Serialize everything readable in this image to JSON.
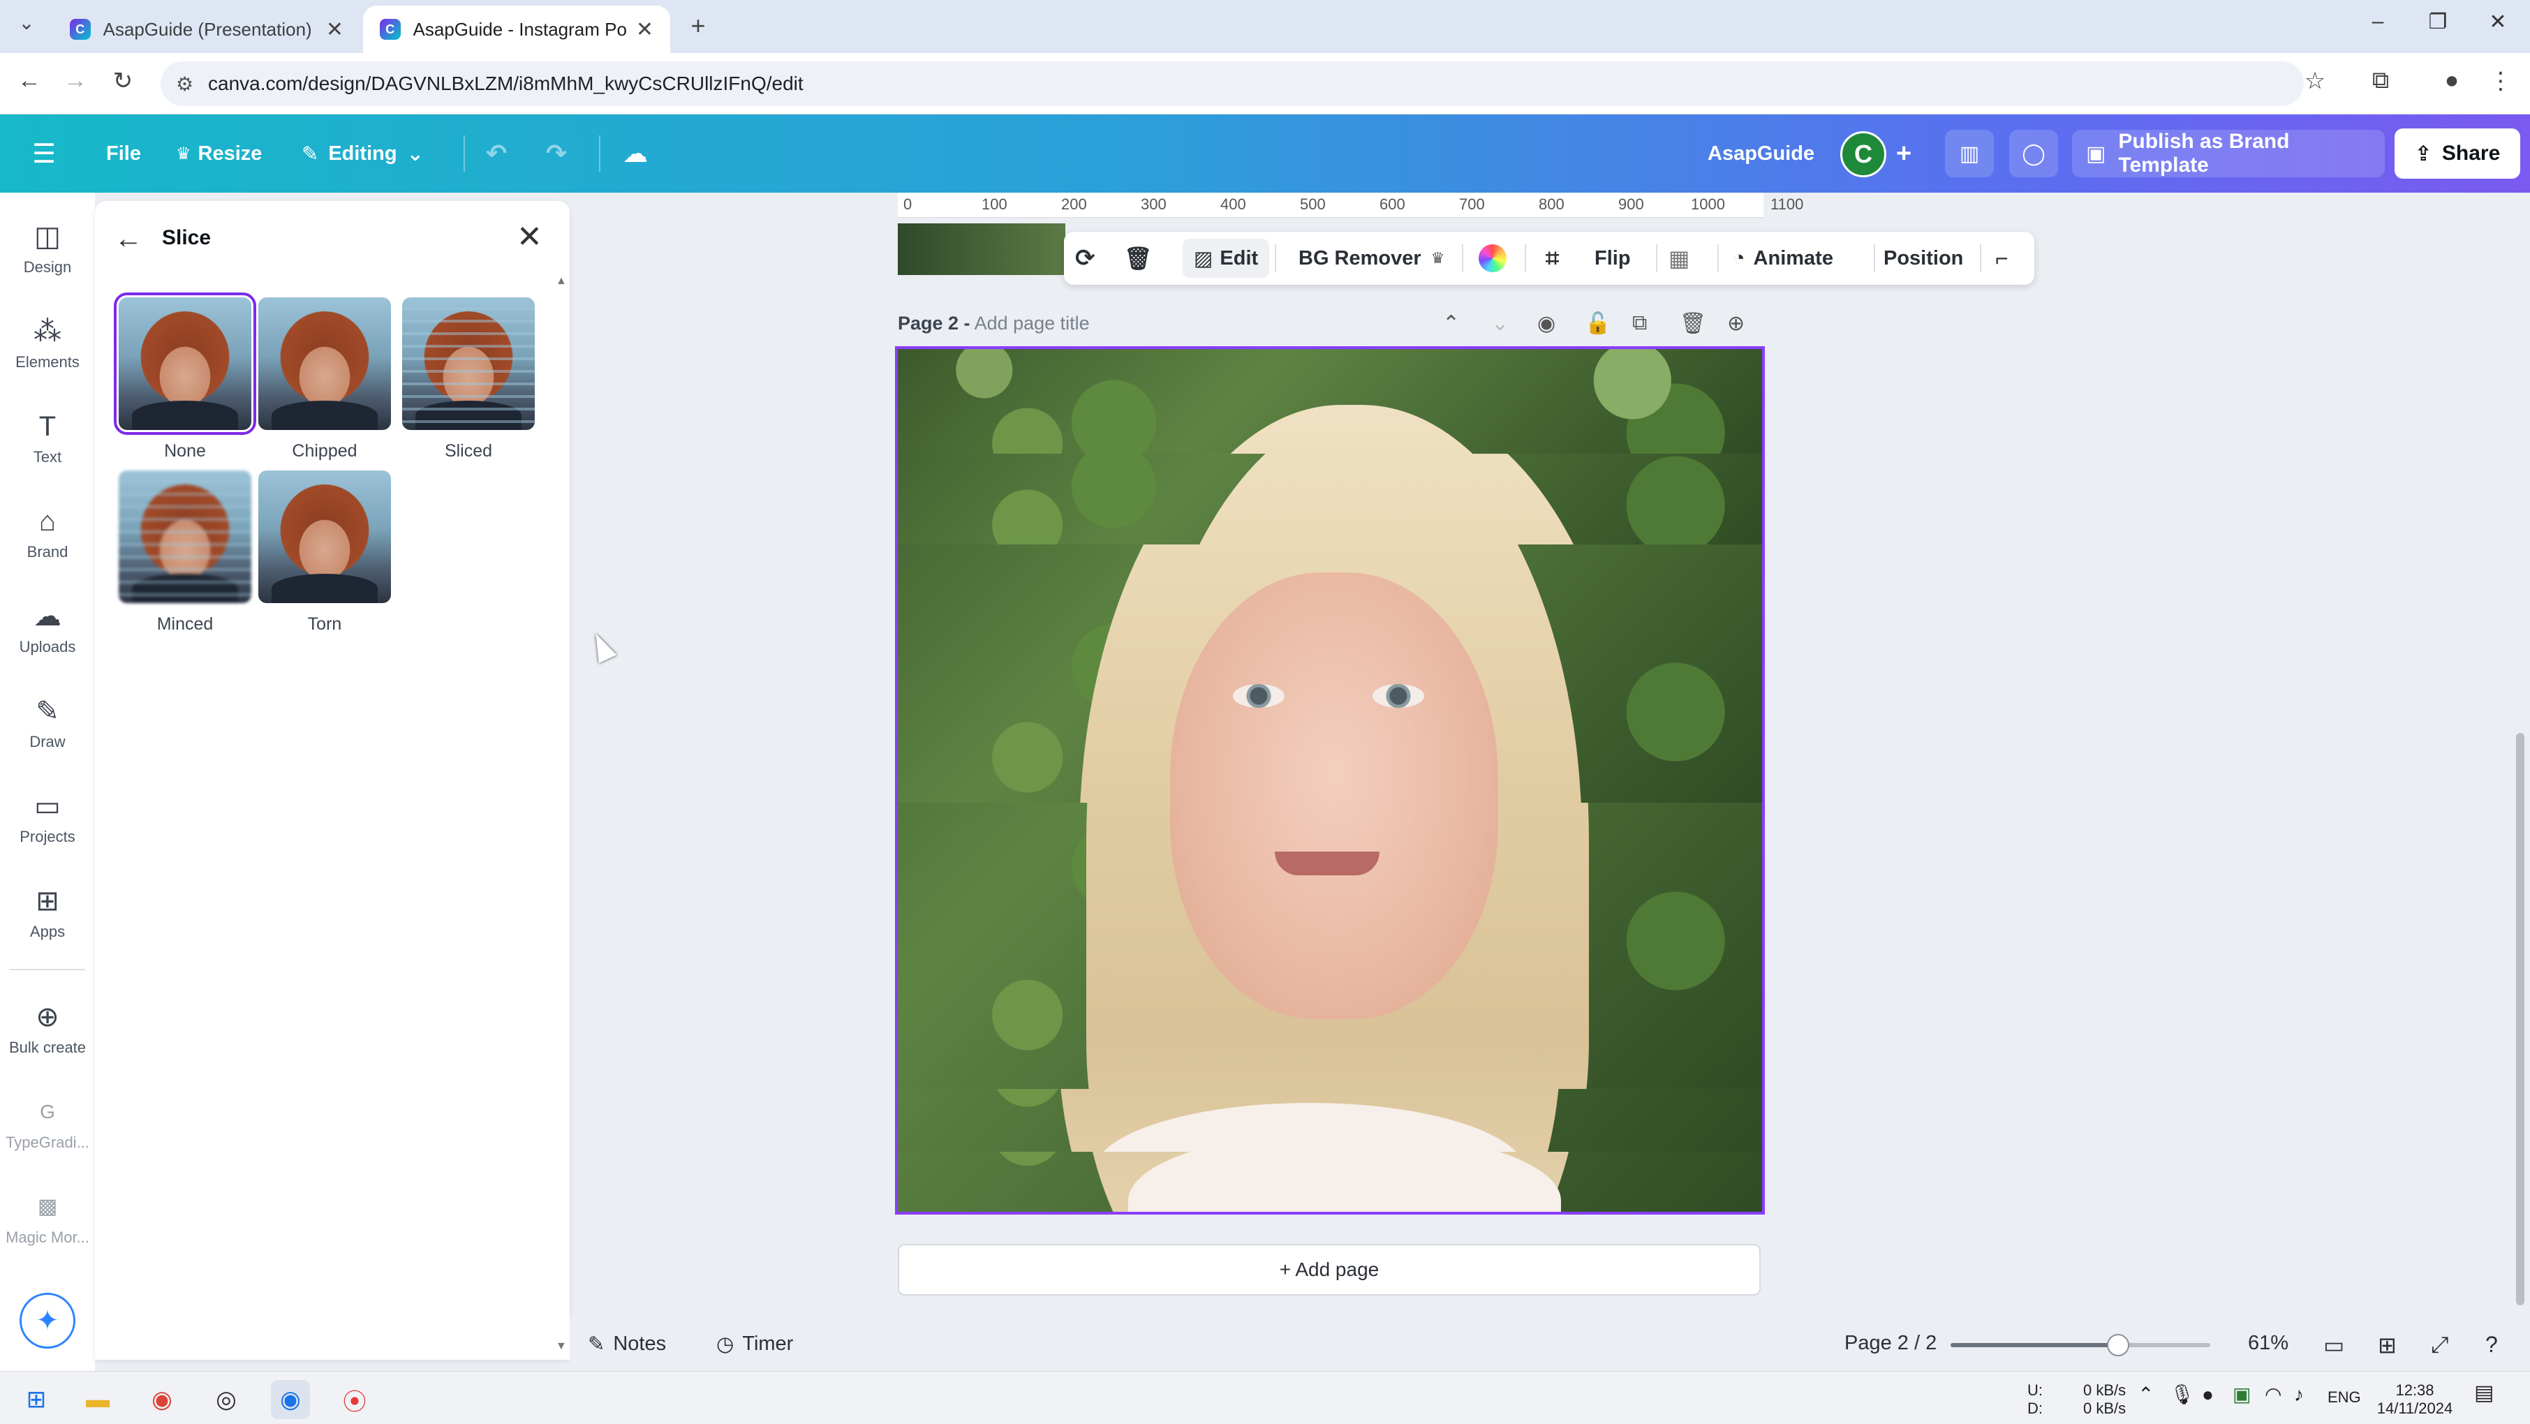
{
  "browser": {
    "tabs": [
      {
        "title": "AsapGuide (Presentation) - Pre",
        "active": false
      },
      {
        "title": "AsapGuide - Instagram Post",
        "active": true
      }
    ],
    "url": "canva.com/design/DAGVNLBxLZM/i8mMhM_kwyCsCRUllzIFnQ/edit",
    "window_controls": {
      "minimize": "–",
      "restore": "❐",
      "close": "✕"
    }
  },
  "topbar": {
    "menu_icon": "hamburger-icon",
    "file_label": "File",
    "resize_label": "Resize",
    "editing_label": "Editing",
    "brand_name": "AsapGuide",
    "avatar_letter": "C",
    "publish_label": "Publish as Brand Template",
    "share_label": "Share"
  },
  "rail": {
    "items": [
      {
        "label": "Design",
        "icon": "design-icon"
      },
      {
        "label": "Elements",
        "icon": "elements-icon"
      },
      {
        "label": "Text",
        "icon": "text-icon"
      },
      {
        "label": "Brand",
        "icon": "brand-icon"
      },
      {
        "label": "Uploads",
        "icon": "uploads-icon"
      },
      {
        "label": "Draw",
        "icon": "draw-icon"
      },
      {
        "label": "Projects",
        "icon": "projects-icon"
      },
      {
        "label": "Apps",
        "icon": "apps-icon"
      },
      {
        "label": "Bulk create",
        "icon": "bulk-create-icon"
      },
      {
        "label": "TypeGradi...",
        "icon": "typegradient-icon"
      },
      {
        "label": "Magic Mor...",
        "icon": "magic-morph-icon"
      }
    ]
  },
  "panel": {
    "title": "Slice",
    "effects": [
      {
        "label": "None",
        "selected": true
      },
      {
        "label": "Chipped",
        "selected": false
      },
      {
        "label": "Sliced",
        "selected": false
      },
      {
        "label": "Minced",
        "selected": false
      },
      {
        "label": "Torn",
        "selected": false
      }
    ]
  },
  "ruler": {
    "ticks": [
      "0",
      "100",
      "200",
      "300",
      "400",
      "500",
      "600",
      "700",
      "800",
      "900",
      "1000",
      "1100"
    ]
  },
  "context_toolbar": {
    "edit_label": "Edit",
    "bg_remover_label": "BG Remover",
    "flip_label": "Flip",
    "animate_label": "Animate",
    "position_label": "Position"
  },
  "page": {
    "name": "Page 2 -",
    "title_placeholder": "Add page title",
    "add_page_label": "+ Add page"
  },
  "bottombar": {
    "notes_label": "Notes",
    "timer_label": "Timer",
    "page_counter": "Page 2 / 2",
    "zoom_label": "61%",
    "zoom_fraction": 0.61
  },
  "taskbar": {
    "net_up_label": "U:",
    "net_down_label": "D:",
    "net_up": "0 kB/s",
    "net_down": "0 kB/s",
    "language": "ENG",
    "time": "12:38",
    "date": "14/11/2024"
  }
}
